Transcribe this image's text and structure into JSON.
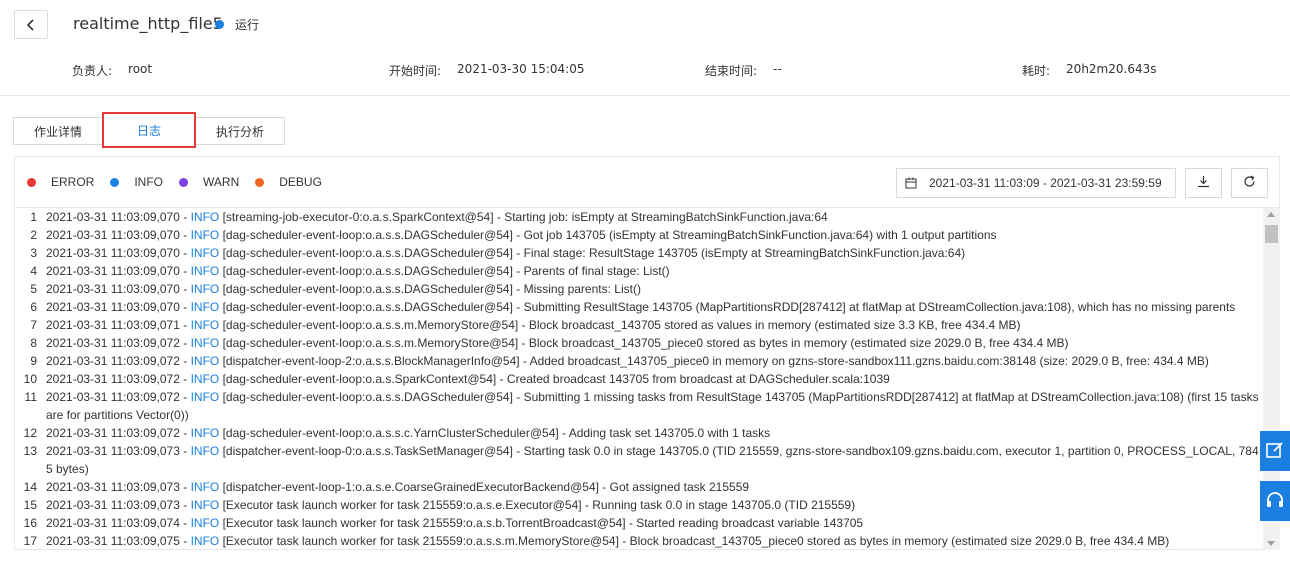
{
  "header": {
    "job_name": "realtime_http_file5",
    "status_text": "运行",
    "status_color": "#1a7fe0",
    "back_icon": "chevron-left-icon"
  },
  "meta": {
    "owner_label": "负责人:",
    "owner_value": "root",
    "start_label": "开始时间:",
    "start_value": "2021-03-30 15:04:05",
    "end_label": "结束时间:",
    "end_value": "--",
    "duration_label": "耗时:",
    "duration_value": "20h2m20.643s"
  },
  "tabs": [
    {
      "label": "作业详情"
    },
    {
      "label": "日志"
    },
    {
      "label": "执行分析"
    }
  ],
  "legend": [
    {
      "label": "ERROR",
      "color": "#e53935"
    },
    {
      "label": "INFO",
      "color": "#1a7fe0"
    },
    {
      "label": "WARN",
      "color": "#7b3fe4"
    },
    {
      "label": "DEBUG",
      "color": "#f26522"
    }
  ],
  "toolbar": {
    "date_range": "2021-03-31 11:03:09 - 2021-03-31 23:59:59",
    "calendar_icon": "calendar-icon",
    "download_icon": "download-icon",
    "refresh_icon": "refresh-icon"
  },
  "log_lines": [
    {
      "num": "1",
      "ts": "2021-03-31 11:03:09,070 - ",
      "level": "INFO",
      "msg": " [streaming-job-executor-0:o.a.s.SparkContext@54] - Starting job: isEmpty at StreamingBatchSinkFunction.java:64"
    },
    {
      "num": "2",
      "ts": "2021-03-31 11:03:09,070 - ",
      "level": "INFO",
      "msg": " [dag-scheduler-event-loop:o.a.s.s.DAGScheduler@54] - Got job 143705 (isEmpty at StreamingBatchSinkFunction.java:64) with 1 output partitions"
    },
    {
      "num": "3",
      "ts": "2021-03-31 11:03:09,070 - ",
      "level": "INFO",
      "msg": " [dag-scheduler-event-loop:o.a.s.s.DAGScheduler@54] - Final stage: ResultStage 143705 (isEmpty at StreamingBatchSinkFunction.java:64)"
    },
    {
      "num": "4",
      "ts": "2021-03-31 11:03:09,070 - ",
      "level": "INFO",
      "msg": " [dag-scheduler-event-loop:o.a.s.s.DAGScheduler@54] - Parents of final stage: List()"
    },
    {
      "num": "5",
      "ts": "2021-03-31 11:03:09,070 - ",
      "level": "INFO",
      "msg": " [dag-scheduler-event-loop:o.a.s.s.DAGScheduler@54] - Missing parents: List()"
    },
    {
      "num": "6",
      "ts": "2021-03-31 11:03:09,070 - ",
      "level": "INFO",
      "msg": " [dag-scheduler-event-loop:o.a.s.s.DAGScheduler@54] - Submitting ResultStage 143705 (MapPartitionsRDD[287412] at flatMap at DStreamCollection.java:108), which has no missing parents"
    },
    {
      "num": "7",
      "ts": "2021-03-31 11:03:09,071 - ",
      "level": "INFO",
      "msg": " [dag-scheduler-event-loop:o.a.s.s.m.MemoryStore@54] - Block broadcast_143705 stored as values in memory (estimated size 3.3 KB, free 434.4 MB)"
    },
    {
      "num": "8",
      "ts": "2021-03-31 11:03:09,072 - ",
      "level": "INFO",
      "msg": " [dag-scheduler-event-loop:o.a.s.s.m.MemoryStore@54] - Block broadcast_143705_piece0 stored as bytes in memory (estimated size 2029.0 B, free 434.4 MB)"
    },
    {
      "num": "9",
      "ts": "2021-03-31 11:03:09,072 - ",
      "level": "INFO",
      "msg": " [dispatcher-event-loop-2:o.a.s.s.BlockManagerInfo@54] - Added broadcast_143705_piece0 in memory on gzns-store-sandbox111.gzns.baidu.com:38148 (size: 2029.0 B, free: 434.4 MB)"
    },
    {
      "num": "10",
      "ts": "2021-03-31 11:03:09,072 - ",
      "level": "INFO",
      "msg": " [dag-scheduler-event-loop:o.a.s.SparkContext@54] - Created broadcast 143705 from broadcast at DAGScheduler.scala:1039"
    },
    {
      "num": "11",
      "ts": "2021-03-31 11:03:09,072 - ",
      "level": "INFO",
      "msg": " [dag-scheduler-event-loop:o.a.s.s.DAGScheduler@54] - Submitting 1 missing tasks from ResultStage 143705 (MapPartitionsRDD[287412] at flatMap at DStreamCollection.java:108) (first 15 tasks are for partitions Vector(0))"
    },
    {
      "num": "12",
      "ts": "2021-03-31 11:03:09,072 - ",
      "level": "INFO",
      "msg": " [dag-scheduler-event-loop:o.a.s.s.c.YarnClusterScheduler@54] - Adding task set 143705.0 with 1 tasks"
    },
    {
      "num": "13",
      "ts": "2021-03-31 11:03:09,073 - ",
      "level": "INFO",
      "msg": " [dispatcher-event-loop-0:o.a.s.s.TaskSetManager@54] - Starting task 0.0 in stage 143705.0 (TID 215559, gzns-store-sandbox109.gzns.baidu.com, executor 1, partition 0, PROCESS_LOCAL, 7845 bytes)"
    },
    {
      "num": "14",
      "ts": "2021-03-31 11:03:09,073 - ",
      "level": "INFO",
      "msg": " [dispatcher-event-loop-1:o.a.s.e.CoarseGrainedExecutorBackend@54] - Got assigned task 215559"
    },
    {
      "num": "15",
      "ts": "2021-03-31 11:03:09,073 - ",
      "level": "INFO",
      "msg": " [Executor task launch worker for task 215559:o.a.s.e.Executor@54] - Running task 0.0 in stage 143705.0 (TID 215559)"
    },
    {
      "num": "16",
      "ts": "2021-03-31 11:03:09,074 - ",
      "level": "INFO",
      "msg": " [Executor task launch worker for task 215559:o.a.s.b.TorrentBroadcast@54] - Started reading broadcast variable 143705"
    },
    {
      "num": "17",
      "ts": "2021-03-31 11:03:09,075 - ",
      "level": "INFO",
      "msg": " [Executor task launch worker for task 215559:o.a.s.s.m.MemoryStore@54] - Block broadcast_143705_piece0 stored as bytes in memory (estimated size 2029.0 B, free 434.4 MB)"
    }
  ],
  "side_buttons": [
    {
      "icon": "edit-icon"
    },
    {
      "icon": "headset-icon"
    }
  ]
}
